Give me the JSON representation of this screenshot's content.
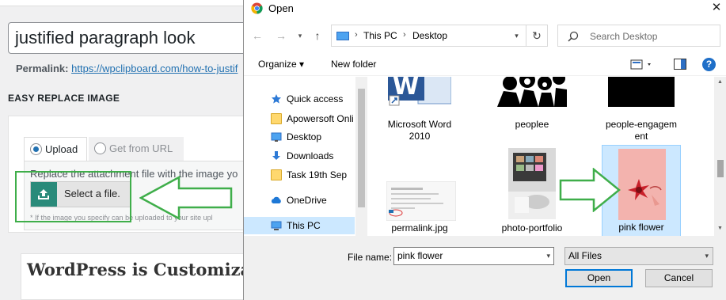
{
  "wp": {
    "title_value": "justified paragraph look",
    "permalink_label": "Permalink:",
    "permalink_url": "https://wpclipboard.com/how-to-justif",
    "section_heading": "EASY REPLACE IMAGE",
    "tab_upload": "Upload",
    "tab_url": "Get from URL",
    "replace_text": "Replace  the attachment file with the image yo",
    "select_file_label": "Select a file.",
    "note": "* If the image you specify can be uploaded to your site upl",
    "editor_heading": "WordPress is Customiza"
  },
  "dialog": {
    "title": "Open",
    "close": "✕",
    "breadcrumb": [
      "This PC",
      "Desktop"
    ],
    "search_placeholder": "Search Desktop",
    "organize_label": "Organize ▾",
    "new_folder_label": "New folder",
    "help_label": "?",
    "nav_items": [
      {
        "label": "Quick access",
        "icon": "star-icon"
      },
      {
        "label": "Apowersoft Onli",
        "icon": "folder-icon"
      },
      {
        "label": "Desktop",
        "icon": "desktop-icon"
      },
      {
        "label": "Downloads",
        "icon": "download-icon"
      },
      {
        "label": "Task 19th Sep",
        "icon": "folder-icon"
      },
      {
        "label": "OneDrive",
        "icon": "cloud-icon"
      },
      {
        "label": "This PC",
        "icon": "pc-icon"
      }
    ],
    "files": [
      {
        "name": "Microsoft Word 2010",
        "line1": "Microsoft Word",
        "line2": "2010"
      },
      {
        "name": "peoplee",
        "line1": "peoplee",
        "line2": ""
      },
      {
        "name": "people-engagement",
        "line1": "people-engagem",
        "line2": "ent"
      },
      {
        "name": "permalink.jpg",
        "line1": "permalink.jpg",
        "line2": ""
      },
      {
        "name": "photo-portfolio",
        "line1": "photo-portfolio",
        "line2": ""
      },
      {
        "name": "pink flower",
        "line1": "pink flower",
        "line2": ""
      }
    ],
    "selected_file": "pink flower",
    "file_name_label": "File name:",
    "file_name_value": "pink flower",
    "file_type_value": "All Files",
    "open_label": "Open",
    "cancel_label": "Cancel"
  },
  "colors": {
    "accent": "#0078d7",
    "selection": "#cce8ff",
    "annotation_green": "#3fae4a",
    "wp_link": "#2271b1",
    "upload_icon_bg": "#2a8a7a"
  }
}
